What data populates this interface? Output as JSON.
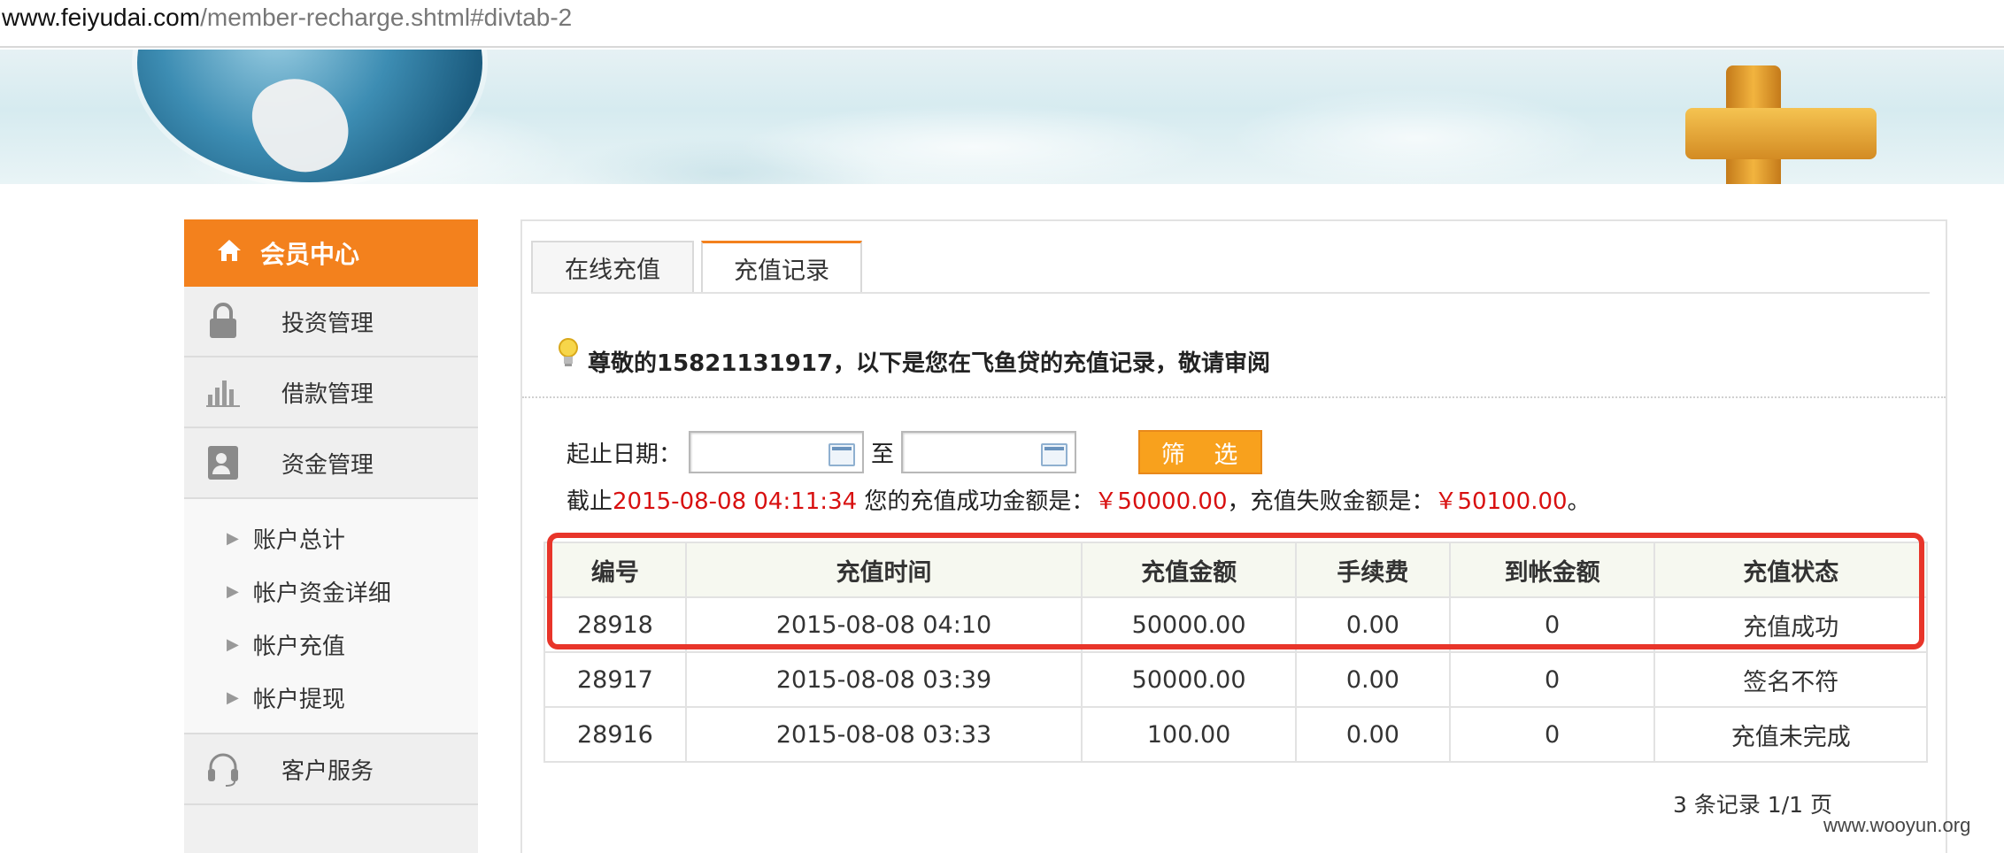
{
  "browser": {
    "url_host": "www.feiyudai.com",
    "url_path": "/member-recharge.shtml#divtab-2"
  },
  "sidebar": {
    "header": "会员中心",
    "items": [
      {
        "label": "投资管理",
        "icon": "lock-icon"
      },
      {
        "label": "借款管理",
        "icon": "bar-chart-icon"
      },
      {
        "label": "资金管理",
        "icon": "user-card-icon"
      }
    ],
    "sub_items": [
      "账户总计",
      "帐户资金详细",
      "帐户充值",
      "帐户提现"
    ],
    "bottom_items": [
      {
        "label": "客户服务",
        "icon": "headset-icon"
      }
    ]
  },
  "tabs": [
    {
      "label": "在线充值",
      "active": false
    },
    {
      "label": "充值记录",
      "active": true
    }
  ],
  "notice": "尊敬的15821131917，以下是您在飞鱼贷的充值记录，敬请审阅",
  "filter": {
    "label": "起止日期：",
    "to_label": "至",
    "start_value": "",
    "end_value": "",
    "button_label": "筛 选"
  },
  "summary": {
    "prefix": "截止",
    "timestamp": "2015-08-08 04:11:34",
    "mid1": " 您的充值成功金额是：",
    "success_amount": "￥50000.00",
    "mid2": "，充值失败金额是：",
    "fail_amount": "￥50100.00",
    "suffix": "。"
  },
  "table": {
    "headers": [
      "编号",
      "充值时间",
      "充值金额",
      "手续费",
      "到帐金额",
      "充值状态"
    ],
    "rows": [
      [
        "28918",
        "2015-08-08 04:10",
        "50000.00",
        "0.00",
        "0",
        "充值成功"
      ],
      [
        "28917",
        "2015-08-08 03:39",
        "50000.00",
        "0.00",
        "0",
        "签名不符"
      ],
      [
        "28916",
        "2015-08-08 03:33",
        "100.00",
        "0.00",
        "0",
        "充值未完成"
      ]
    ]
  },
  "pager": "3 条记录 1/1 页",
  "watermark": "www.wooyun.org",
  "colors": {
    "accent": "#f3811d",
    "button": "#f8a11d",
    "highlight": "#e8352a",
    "red_text": "#d81010"
  }
}
